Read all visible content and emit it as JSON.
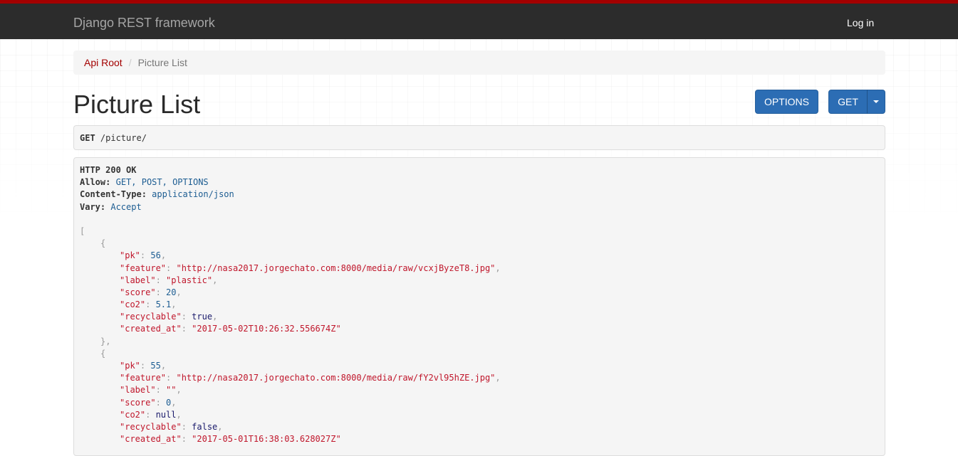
{
  "navbar": {
    "brand": "Django REST framework",
    "login_label": "Log in",
    "accent_color": "#a30000",
    "background_color": "#2c2c2c"
  },
  "breadcrumb": {
    "root_label": "Api Root",
    "current_label": "Picture List"
  },
  "page": {
    "title": "Picture List"
  },
  "buttons": {
    "options_label": "OPTIONS",
    "get_label": "GET",
    "button_color": "#2c6db4"
  },
  "request": {
    "method": "GET",
    "path": " /picture/"
  },
  "response": {
    "status_line": "HTTP 200 OK",
    "headers": [
      {
        "name": "Allow:",
        "value": "GET, POST, OPTIONS"
      },
      {
        "name": "Content-Type:",
        "value": "application/json"
      },
      {
        "name": "Vary:",
        "value": "Accept"
      }
    ],
    "items": [
      {
        "pk": "56",
        "feature": "\"http://nasa2017.jorgechato.com:8000/media/raw/vcxjByzeT8.jpg\"",
        "label": "\"plastic\"",
        "score": "20",
        "co2": "5.1",
        "recyclable": "true",
        "created_at": "\"2017-05-02T10:26:32.556674Z\""
      },
      {
        "pk": "55",
        "feature": "\"http://nasa2017.jorgechato.com:8000/media/raw/fY2vl95hZE.jpg\"",
        "label": "\"\"",
        "score": "0",
        "co2": "null",
        "recyclable": "false",
        "created_at": "\"2017-05-01T16:38:03.628027Z\""
      }
    ],
    "keys": {
      "pk": "\"pk\"",
      "feature": "\"feature\"",
      "label": "\"label\"",
      "score": "\"score\"",
      "co2": "\"co2\"",
      "recyclable": "\"recyclable\"",
      "created_at": "\"created_at\""
    }
  }
}
